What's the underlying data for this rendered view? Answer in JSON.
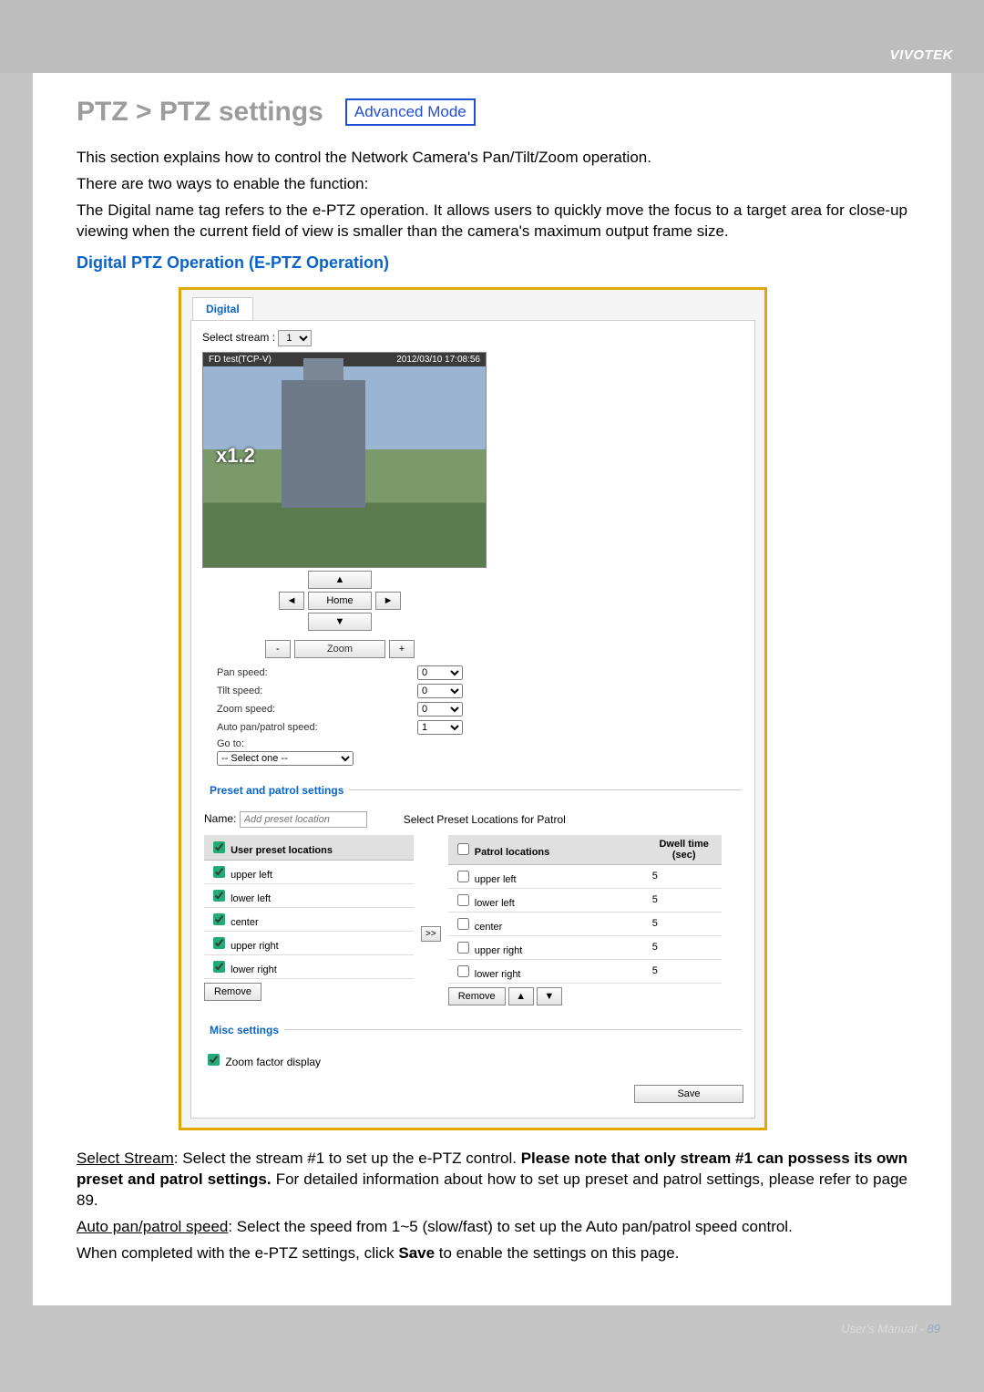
{
  "brand": "VIVOTEK",
  "footer_label": "User's Manual - ",
  "page_number": "89",
  "heading": "PTZ > PTZ settings",
  "mode_tag": "Advanced Mode",
  "intro1": "This section explains how to control the Network Camera's Pan/Tilt/Zoom operation.",
  "intro2": "There are two ways to enable the function:",
  "intro3": "The Digital name tag refers to the e-PTZ operation. It allows users to quickly move the focus to a target area for close-up viewing when the current field of view is smaller than the camera's maximum output frame size.",
  "section_heading": "Digital PTZ Operation (E-PTZ Operation)",
  "panel": {
    "tab_label": "Digital",
    "select_stream_label": "Select stream :",
    "select_stream_value": "1",
    "video": {
      "title": "FD test(TCP-V)",
      "timestamp": "2012/03/10  17:08:56",
      "zoom_factor": "x1.2"
    },
    "controls": {
      "home": "Home",
      "zoom": "Zoom",
      "pan_speed_label": "Pan speed:",
      "pan_speed_value": "0",
      "tilt_speed_label": "Tilt speed:",
      "tilt_speed_value": "0",
      "zoom_speed_label": "Zoom speed:",
      "zoom_speed_value": "0",
      "auto_speed_label": "Auto pan/patrol speed:",
      "auto_speed_value": "1",
      "goto_label": "Go to:",
      "goto_placeholder": "-- Select one --"
    },
    "preset_legend": "Preset and patrol settings",
    "name_label": "Name:",
    "name_placeholder": "Add preset location",
    "select_patrol_label": "Select Preset Locations for Patrol",
    "user_preset_header": "User preset locations",
    "patrol_header": "Patrol locations",
    "dwell_header": "Dwell time (sec)",
    "user_presets": [
      {
        "label": "upper left",
        "checked": true
      },
      {
        "label": "lower left",
        "checked": true
      },
      {
        "label": "center",
        "checked": true
      },
      {
        "label": "upper right",
        "checked": true
      },
      {
        "label": "lower right",
        "checked": true
      }
    ],
    "patrol_rows": [
      {
        "label": "upper left",
        "dwell": "5"
      },
      {
        "label": "lower left",
        "dwell": "5"
      },
      {
        "label": "center",
        "dwell": "5"
      },
      {
        "label": "upper right",
        "dwell": "5"
      },
      {
        "label": "lower right",
        "dwell": "5"
      }
    ],
    "move_right": ">>",
    "remove_label": "Remove",
    "misc_legend": "Misc settings",
    "zoom_factor_display": "Zoom factor display",
    "save_label": "Save"
  },
  "body_text": {
    "select_stream_head": "Select Stream",
    "select_stream_body1": ": Select the stream #1 to set up the e-PTZ control. ",
    "select_stream_bold": "Please note that only stream #1 can possess its own preset and patrol settings.",
    "select_stream_body2": " For detailed information about how to set up preset and patrol settings, please refer to page 89.",
    "auto_head": "Auto pan/patrol speed",
    "auto_body": ": Select the speed from 1~5 (slow/fast) to set up the Auto pan/patrol speed control.",
    "save_line1": "When completed with the e-PTZ settings, click ",
    "save_bold": "Save",
    "save_line2": " to enable the settings on this page."
  }
}
